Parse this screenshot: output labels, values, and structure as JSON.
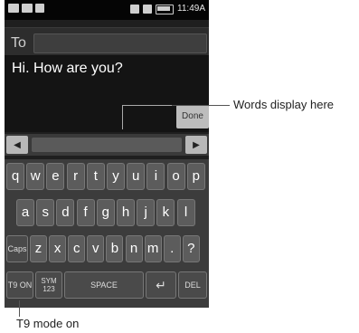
{
  "status_bar": {
    "time": "11:49A",
    "left_icons": [
      "messages-icon",
      "email-icon",
      "usb-icon"
    ],
    "right_icons": [
      "sd-card-icon",
      "signal-icon",
      "battery-icon"
    ]
  },
  "compose": {
    "to_label": "To",
    "to_value": "",
    "message_text": "Hi. How are you?",
    "done_label": "Done"
  },
  "keyboard": {
    "row1": [
      "q",
      "w",
      "e",
      "r",
      "t",
      "y",
      "u",
      "i",
      "o",
      "p"
    ],
    "row2": [
      "a",
      "s",
      "d",
      "f",
      "g",
      "h",
      "j",
      "k",
      "l"
    ],
    "row3_caps": "Caps",
    "row3": [
      "z",
      "x",
      "c",
      "v",
      "b",
      "n",
      "m",
      ".",
      "?"
    ],
    "t9_label": "T9 ON",
    "sym_label_top": "SYM",
    "sym_label_bottom": "123",
    "space_label": "SPACE",
    "enter_glyph": "↵",
    "del_label": "DEL"
  },
  "annotations": {
    "words_display": "Words display here",
    "t9_mode": "T9 mode on"
  }
}
